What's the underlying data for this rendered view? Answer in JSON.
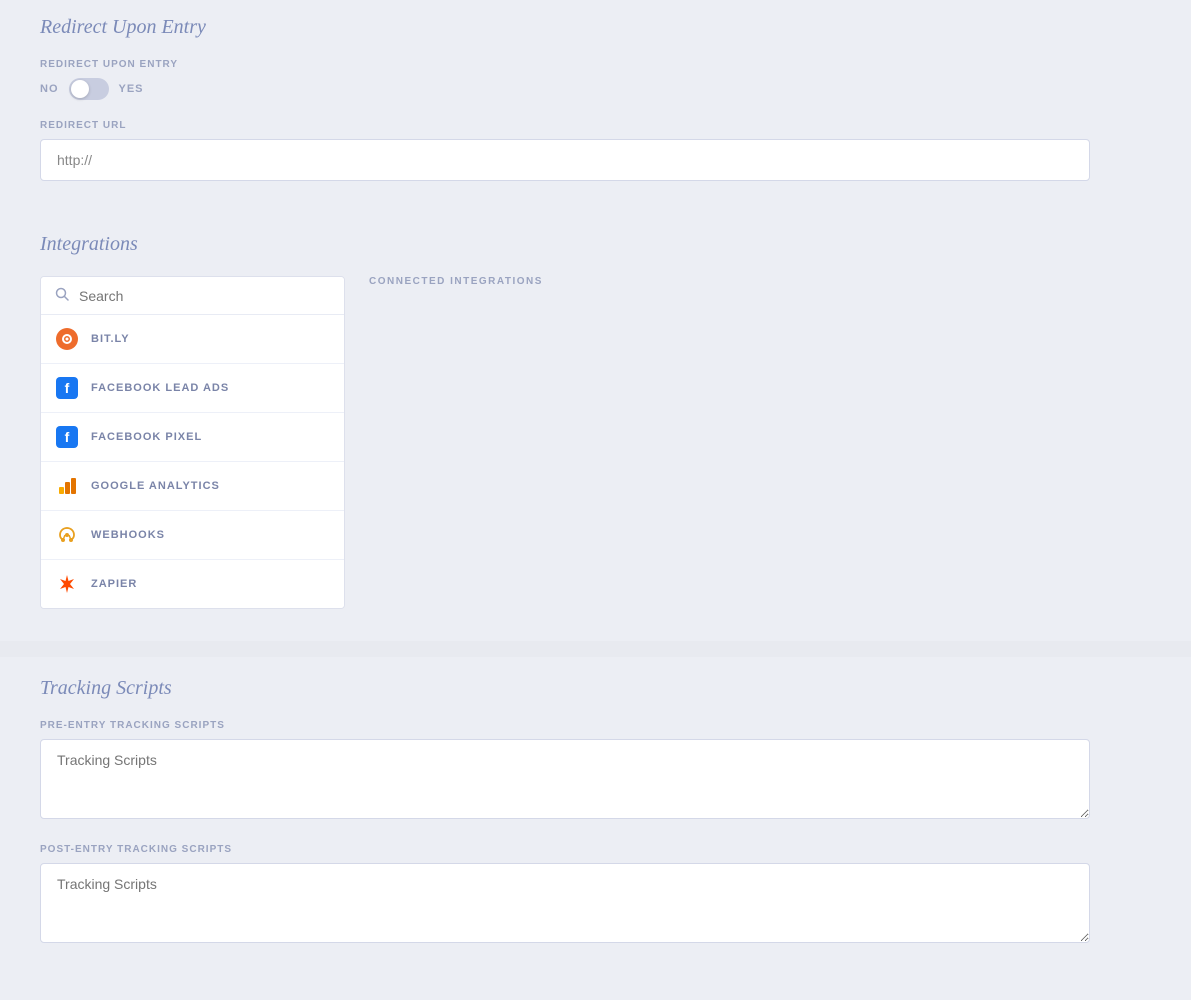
{
  "redirect_section": {
    "title": "Redirect Upon Entry",
    "field_label": "REDIRECT UPON ENTRY",
    "toggle_no": "NO",
    "toggle_yes": "YES",
    "toggle_state": false,
    "redirect_url_label": "REDIRECT URL",
    "redirect_url_placeholder": "http://"
  },
  "integrations_section": {
    "title": "Integrations",
    "connected_label": "CONNECTED INTEGRATIONS",
    "search_placeholder": "Search",
    "items": [
      {
        "id": "bitly",
        "name": "BIT.LY",
        "icon_type": "bitly"
      },
      {
        "id": "fb-lead-ads",
        "name": "FACEBOOK LEAD ADS",
        "icon_type": "facebook"
      },
      {
        "id": "fb-pixel",
        "name": "FACEBOOK PIXEL",
        "icon_type": "facebook"
      },
      {
        "id": "google-analytics",
        "name": "GOOGLE ANALYTICS",
        "icon_type": "ga"
      },
      {
        "id": "webhooks",
        "name": "WEBHOOKS",
        "icon_type": "webhooks"
      },
      {
        "id": "zapier",
        "name": "ZAPIER",
        "icon_type": "zapier"
      }
    ]
  },
  "tracking_section": {
    "title": "Tracking Scripts",
    "pre_entry_label": "PRE-ENTRY TRACKING SCRIPTS",
    "pre_entry_placeholder": "Tracking Scripts",
    "post_entry_label": "POST-ENTRY TRACKING SCRIPTS",
    "post_entry_placeholder": "Tracking Scripts"
  }
}
